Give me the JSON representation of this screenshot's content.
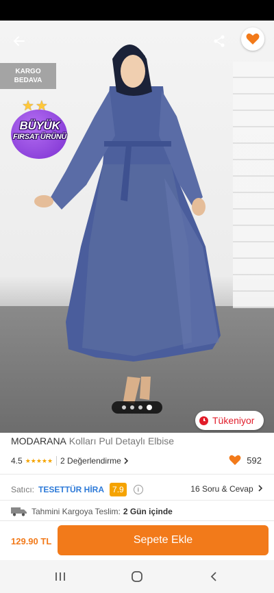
{
  "colors": {
    "brand_orange": "#F27A1A",
    "seller_blue": "#2D7AD8",
    "stock_red": "#E11D2A",
    "badge_purple": "#7B2FD0",
    "rating_star": "#F5A300"
  },
  "hero": {
    "back_icon": "arrow-left-icon",
    "share_icon": "share-icon",
    "favorite_icon": "heart-icon",
    "cargo_badge": [
      "KARGO",
      "BEDAVA"
    ],
    "campaign_badge": [
      "BÜYÜK",
      "FIRSAT ÜRÜNÜ"
    ],
    "carousel": {
      "count": 4,
      "active_index": 0
    },
    "stock_badge": "Tükeniyor"
  },
  "product": {
    "brand": "MODARANA",
    "name": "Kolları Pul Detaylı Elbise",
    "rating": "4.5",
    "rating_stars": 4.5,
    "reviews_label": "2 Değerlendirme",
    "likes": "592"
  },
  "seller": {
    "label": "Satıcı:",
    "name": "TESETTÜR HİRA",
    "score": "7.9",
    "qa_label": "16 Soru & Cevap"
  },
  "shipping": {
    "icon": "truck-icon",
    "label": "Tahmini Kargoya Teslim:",
    "value": "2 Gün içinde"
  },
  "buy_bar": {
    "price": "129.90 TL",
    "add_to_cart": "Sepete Ekle"
  },
  "navigation": {
    "recents_icon": "recents-icon",
    "home_icon": "home-icon",
    "back_icon": "back-chevron-icon"
  }
}
